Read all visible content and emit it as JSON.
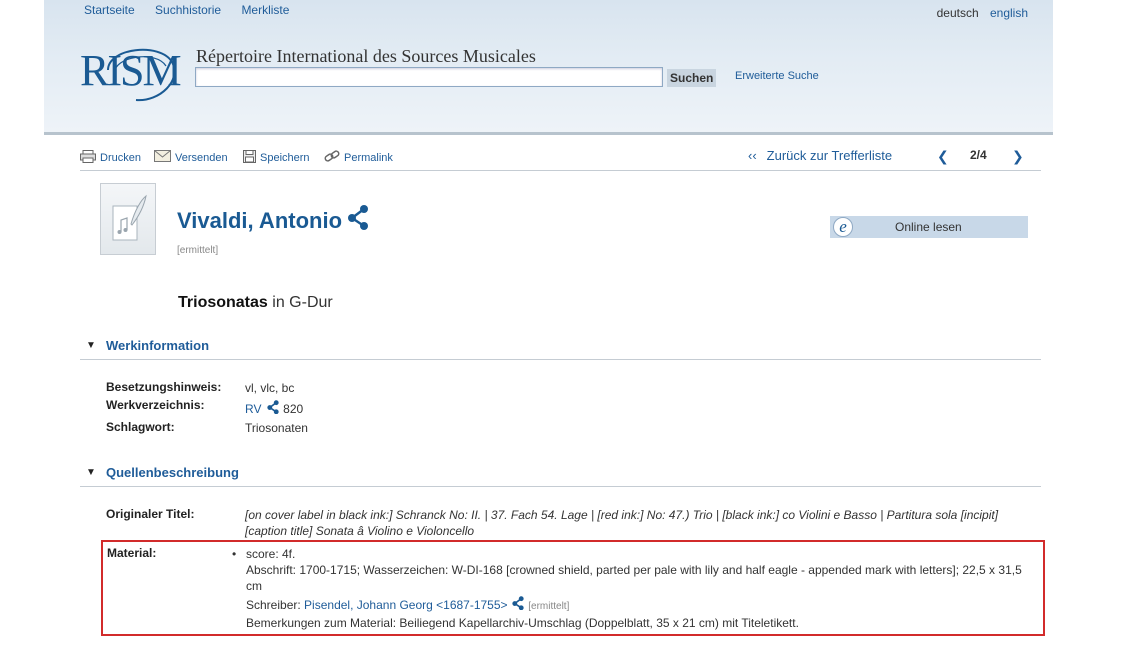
{
  "nav": {
    "links": [
      "Startseite",
      "Suchhistorie",
      "Merkliste"
    ],
    "lang_current": "deutsch",
    "lang_other": "english"
  },
  "header": {
    "logo_text": "RISM",
    "tagline": "Répertoire International des Sources Musicales",
    "search_value": "",
    "search_button": "Suchen",
    "advanced_search": "Erweiterte Suche"
  },
  "toolbar": {
    "print": "Drucken",
    "send": "Versenden",
    "save": "Speichern",
    "permalink": "Permalink",
    "back": "Zurück zur Trefferliste",
    "back_glyph": "‹‹",
    "prev_glyph": "❮",
    "next_glyph": "❯",
    "page": "2/4"
  },
  "record": {
    "composer": "Vivaldi, Antonio",
    "composer_note": "[ermittelt]",
    "online_read": "Online lesen",
    "title_bold": "Triosonatas",
    "title_rest": "in G-Dur"
  },
  "sections": {
    "werk": {
      "heading": "Werkinformation",
      "besetzung_label": "Besetzungshinweis:",
      "besetzung_value": "vl, vlc, bc",
      "verzeichnis_label": "Werkverzeichnis:",
      "verzeichnis_link": "RV",
      "verzeichnis_number": "820",
      "schlagwort_label": "Schlagwort:",
      "schlagwort_value": "Triosonaten"
    },
    "quelle": {
      "heading": "Quellenbeschreibung",
      "orig_title_label": "Originaler Titel:",
      "orig_title_line1": "[on cover label in black ink:] Schranck No: II. | 37. Fach 54. Lage | [red ink:] No: 47.) Trio | [black ink:] co Violini e Basso | Partitura sola [incipit]",
      "orig_title_line2": "[caption title] Sonata â Violino e Violoncello",
      "material_label": "Material:",
      "material_score": "score: 4f.",
      "material_abschrift": "Abschrift: 1700-1715; Wasserzeichen: W-DI-168 [crowned shield, parted per pale with lily and half eagle - appended mark with letters]; 22,5 x 31,5 cm",
      "material_schreiber_prefix": "Schreiber:",
      "material_schreiber_link": "Pisendel, Johann Georg <1687-1755>",
      "material_schreiber_note": "[ermittelt]",
      "material_bemerkungen": "Bemerkungen zum Material: Beiliegend Kapellarchiv-Umschlag (Doppelblatt, 35 x 21 cm) mit Titeletikett."
    }
  },
  "colors": {
    "link": "#1f5c99",
    "highlight_border": "#d22b2b",
    "header_bg": "#dde7f0"
  }
}
